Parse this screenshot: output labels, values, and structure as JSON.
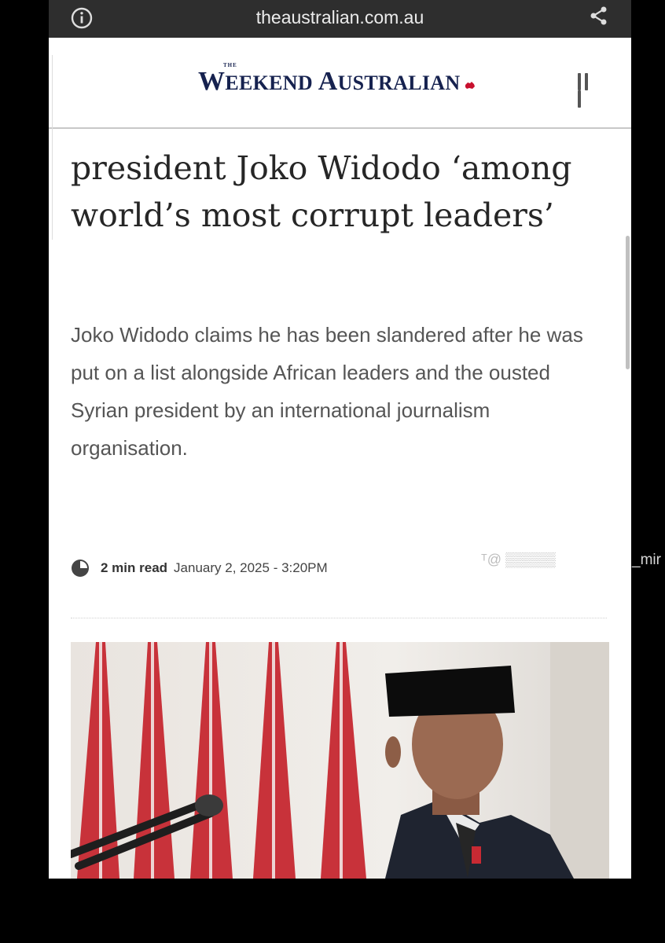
{
  "browser": {
    "url": "theaustralian.com.au",
    "info_icon": "info-icon",
    "share_icon": "share-icon"
  },
  "site": {
    "logo_the": "THE",
    "logo_w": "W",
    "logo_rest1": "EEKEND ",
    "logo_a": "A",
    "logo_rest2": "USTRALIAN",
    "menu_icon": "hamburger-menu-icon"
  },
  "article": {
    "headline": "president Joko Widodo ‘among world’s most corrupt leaders’",
    "standfirst": "Joko Widodo claims he has been slandered after he was put on a list alongside African leaders and the ousted Syrian president by an international journalism organisation.",
    "read_time": "2 min read",
    "date": "January 2, 2025 - 3:20PM",
    "clock_icon": "clock-icon"
  },
  "watermark": {
    "text": "_mir"
  },
  "colors": {
    "brand_navy": "#16224f",
    "flag_red": "#c8102e",
    "url_bar": "#2e2e2e"
  }
}
